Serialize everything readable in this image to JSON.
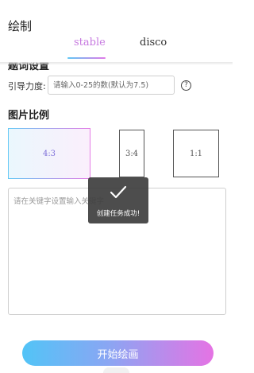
{
  "header": {
    "title": "绘制",
    "tabs": [
      {
        "label": "stable",
        "active": true
      },
      {
        "label": "disco",
        "active": false
      }
    ]
  },
  "settings": {
    "cut_section_title": "题词设置",
    "guide_label": "引导力度:",
    "guide_placeholder": "请输入0-25的数(默认为7.5)",
    "guide_value": "",
    "help_icon": "question-circle-icon"
  },
  "ratio": {
    "title": "图片比例",
    "options": [
      {
        "label": "4:3",
        "selected": true
      },
      {
        "label": "3:4",
        "selected": false
      },
      {
        "label": "1:1",
        "selected": false
      }
    ]
  },
  "keywords": {
    "placeholder": "请在关键字设置输入关键字",
    "value": ""
  },
  "toast": {
    "icon": "check-icon",
    "message": "创建任务成功!"
  },
  "actions": {
    "start_label": "开始绘画"
  },
  "colors": {
    "accent_start": "#52c4f7",
    "accent_end": "#e573e4",
    "tab_active": "#c77ae0"
  }
}
